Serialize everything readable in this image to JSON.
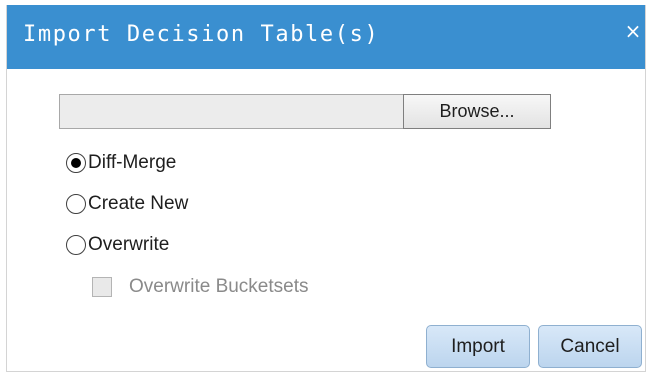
{
  "dialog": {
    "title": "Import Decision Table(s)",
    "close_glyph": "×",
    "close_icon": "close-icon"
  },
  "file": {
    "path_value": "",
    "browse_label": "Browse..."
  },
  "mode": {
    "options": [
      {
        "label": "Diff-Merge",
        "checked": true
      },
      {
        "label": "Create New",
        "checked": false
      },
      {
        "label": "Overwrite",
        "checked": false
      }
    ]
  },
  "overwrite_bucketsets": {
    "label": "Overwrite Bucketsets",
    "checked": false,
    "disabled": true
  },
  "actions": {
    "import_label": "Import",
    "cancel_label": "Cancel"
  },
  "colors": {
    "titlebar": "#3a8fd0",
    "button_bg": "#c9ddf2",
    "disabled_text": "#8a8a8a"
  }
}
